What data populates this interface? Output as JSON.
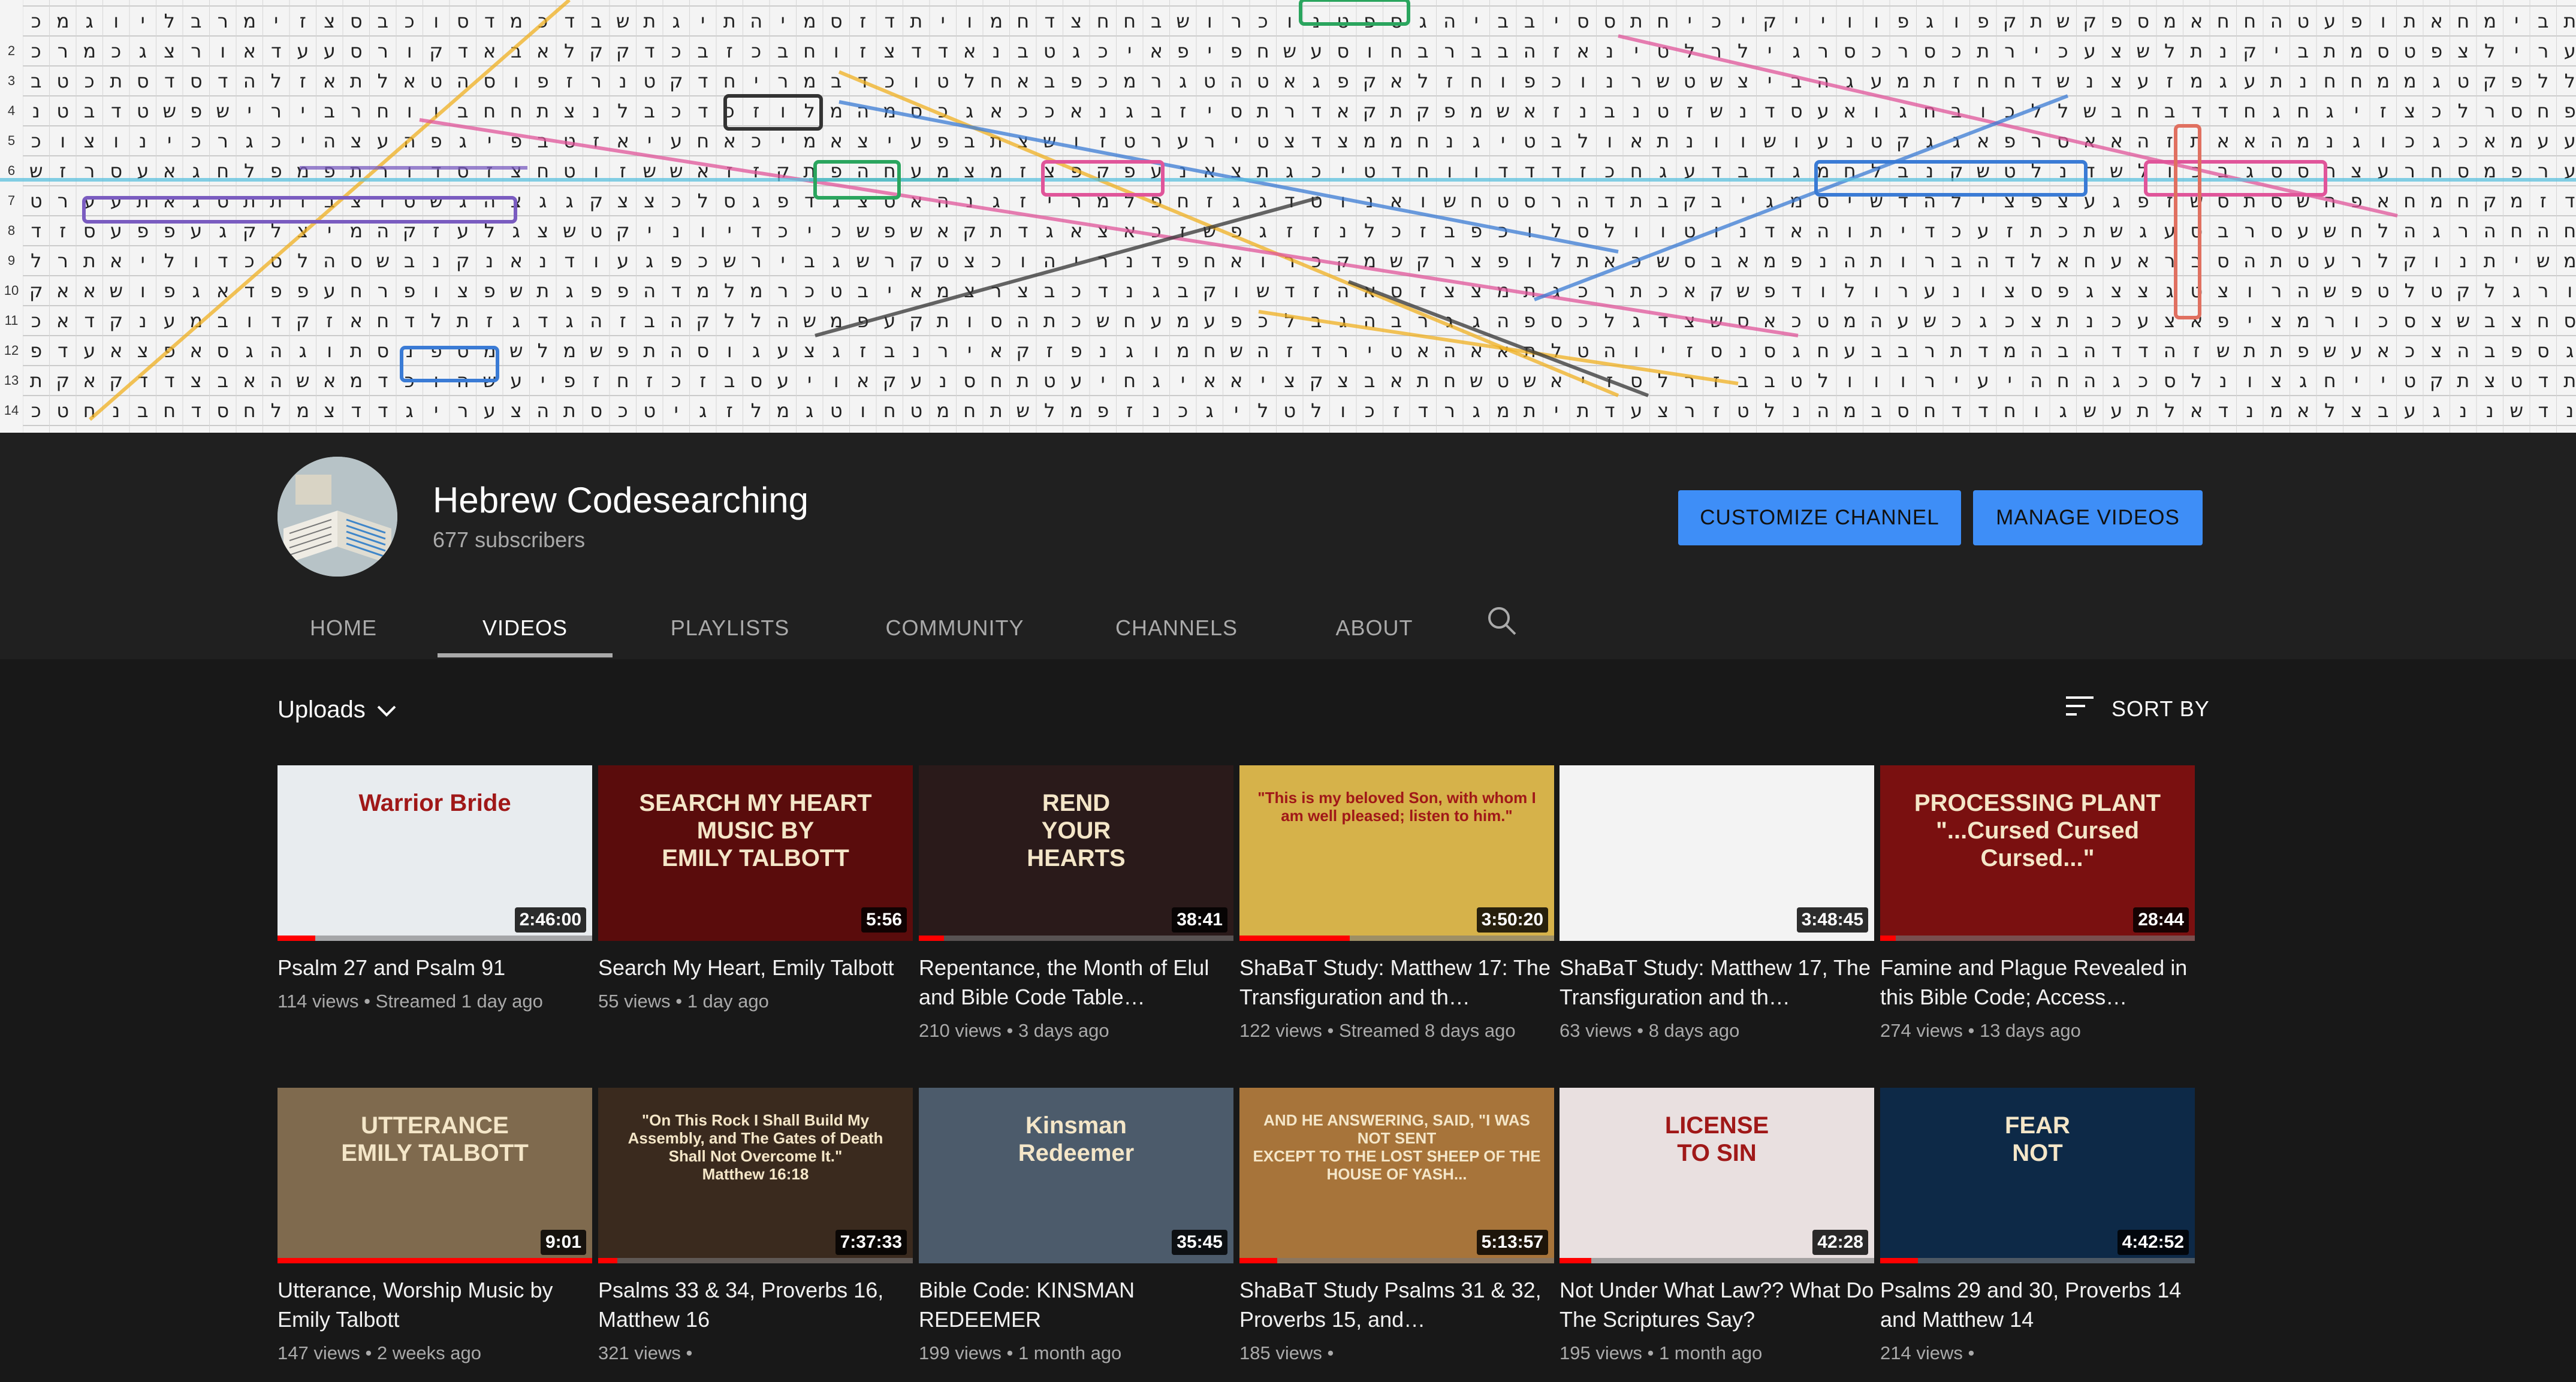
{
  "channel": {
    "name": "Hebrew Codesearching",
    "subscribers": "677 subscribers",
    "customize_label": "CUSTOMIZE CHANNEL",
    "manage_label": "MANAGE VIDEOS"
  },
  "tabs": [
    {
      "label": "HOME",
      "active": false
    },
    {
      "label": "VIDEOS",
      "active": true
    },
    {
      "label": "PLAYLISTS",
      "active": false
    },
    {
      "label": "COMMUNITY",
      "active": false
    },
    {
      "label": "CHANNELS",
      "active": false
    },
    {
      "label": "ABOUT",
      "active": false
    }
  ],
  "controls": {
    "uploads_label": "Uploads",
    "sort_label": "SORT BY"
  },
  "banner": {
    "row_numbers": [
      "2",
      "3",
      "4",
      "5",
      "6",
      "7",
      "8",
      "9",
      "10",
      "11",
      "12",
      "13",
      "14"
    ]
  },
  "videos": [
    {
      "title": "Psalm 27 and Psalm 91",
      "views": "114 views",
      "age": "Streamed 1 day ago",
      "duration": "2:46:00",
      "watched": 0.12,
      "thumb_color": "#e8ecef",
      "thumb_text": "Warrior Bride"
    },
    {
      "title": "Search My Heart, Emily Talbott",
      "views": "55 views",
      "age": "1 day ago",
      "duration": "5:56",
      "watched": 0.0,
      "thumb_color": "#5a0c0c",
      "thumb_text": "SEARCH MY HEART\nMUSIC BY\nEMILY TALBOTT"
    },
    {
      "title": "Repentance, the Month of Elul and Bible Code Table…",
      "views": "210 views",
      "age": "3 days ago",
      "duration": "38:41",
      "watched": 0.08,
      "thumb_color": "#2a1a1a",
      "thumb_text": "REND\nYOUR\nHEARTS"
    },
    {
      "title": "ShaBaT Study: Matthew 17: The Transfiguration and th…",
      "views": "122 views",
      "age": "Streamed 8 days ago",
      "duration": "3:50:20",
      "watched": 0.35,
      "thumb_color": "#d6b24a",
      "thumb_text": "\"This is my beloved Son, with whom I am well pleased; listen to him.\""
    },
    {
      "title": "ShaBaT Study: Matthew 17, The Transfiguration and th…",
      "views": "63 views",
      "age": "8 days ago",
      "duration": "3:48:45",
      "watched": 0.0,
      "thumb_color": "#f3f3f3",
      "thumb_text": ""
    },
    {
      "title": "Famine and Plague Revealed in this Bible Code; Access…",
      "views": "274 views",
      "age": "13 days ago",
      "duration": "28:44",
      "watched": 0.05,
      "thumb_color": "#7a1010",
      "thumb_text": "PROCESSING PLANT\n\"...Cursed Cursed Cursed...\""
    },
    {
      "title": "Utterance, Worship Music by Emily Talbott",
      "views": "147 views",
      "age": "2 weeks ago",
      "duration": "9:01",
      "watched": 1.0,
      "thumb_color": "#7f6a4e",
      "thumb_text": "UTTERANCE\nEMILY TALBOTT"
    },
    {
      "title": "Psalms 33 & 34, Proverbs 16, Matthew 16",
      "views": "321 views",
      "age": "",
      "duration": "7:37:33",
      "watched": 0.06,
      "thumb_color": "#3a2a1e",
      "thumb_text": "\"On This Rock I Shall Build My Assembly, and The Gates of Death Shall Not Overcome It.\"\nMatthew 16:18"
    },
    {
      "title": "Bible Code: KINSMAN REDEEMER",
      "views": "199 views",
      "age": "1 month ago",
      "duration": "35:45",
      "watched": 0.0,
      "thumb_color": "#4c5b6b",
      "thumb_text": "Kinsman\nRedeemer"
    },
    {
      "title": "ShaBaT Study Psalms 31 & 32, Proverbs 15, and…",
      "views": "185 views",
      "age": "",
      "duration": "5:13:57",
      "watched": 0.12,
      "thumb_color": "#a7743a",
      "thumb_text": "AND HE ANSWERING, SAID, \"I WAS NOT SENT\nEXCEPT TO THE LOST SHEEP OF THE HOUSE OF YASH..."
    },
    {
      "title": "Not Under What Law?? What Do The Scriptures Say?",
      "views": "195 views",
      "age": "1 month ago",
      "duration": "42:28",
      "watched": 0.1,
      "thumb_color": "#e9e0e0",
      "thumb_text": "LICENSE\nTO SIN"
    },
    {
      "title": "Psalms 29 and 30, Proverbs 14 and Matthew 14",
      "views": "214 views",
      "age": "",
      "duration": "4:42:52",
      "watched": 0.12,
      "thumb_color": "#0d2947",
      "thumb_text": "FEAR\nNOT"
    }
  ]
}
